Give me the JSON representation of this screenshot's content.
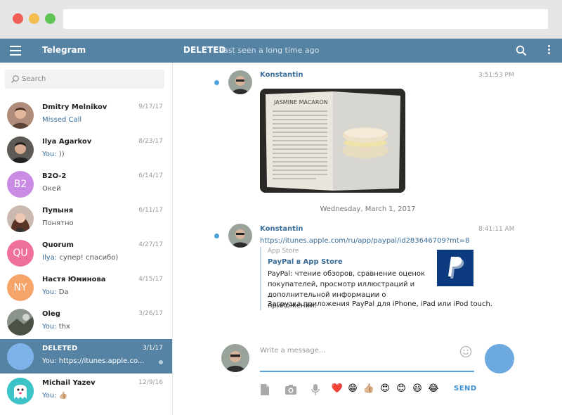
{
  "app": {
    "title": "Telegram"
  },
  "header": {
    "peer_name": "DELETED",
    "peer_status": "last seen a long time ago"
  },
  "search": {
    "placeholder": "Search",
    "value": ""
  },
  "dialogs": [
    {
      "name": "Dmitry Melnikov",
      "date": "9/17/17",
      "sender": "",
      "text": "Missed Call",
      "avatar_initials": "",
      "avatar_color": "#8a6b5b"
    },
    {
      "name": "Ilya Agarkov",
      "date": "8/23/17",
      "sender": "You:",
      "text": " ))",
      "avatar_initials": "",
      "avatar_color": "#3e3a36"
    },
    {
      "name": "B2O-2",
      "date": "6/14/17",
      "sender": "",
      "text": "Окей",
      "avatar_initials": "B2",
      "avatar_color": "#c98be3"
    },
    {
      "name": "Пупыня",
      "date": "6/11/17",
      "sender": "",
      "text": "Понятно",
      "avatar_initials": "",
      "avatar_color": "#6d4a3a"
    },
    {
      "name": "Quorum",
      "date": "4/27/17",
      "sender": "Ilya:",
      "text": " супер! спасибо)",
      "avatar_initials": "QU",
      "avatar_color": "#ef6f9d"
    },
    {
      "name": "Настя Юминова",
      "date": "4/15/17",
      "sender": "You:",
      "text": " Da",
      "avatar_initials": "NY",
      "avatar_color": "#f6a46a"
    },
    {
      "name": "Oleg",
      "date": "3/26/17",
      "sender": "You:",
      "text": " thx",
      "avatar_initials": "",
      "avatar_color": "#6f7a6c"
    },
    {
      "name": "DELETED",
      "date": "3/1/17",
      "sender": "",
      "text": "You: https://itunes.apple.co...",
      "avatar_initials": "",
      "avatar_color": "#7db3e8"
    },
    {
      "name": "Michail Yazev",
      "date": "12/9/16",
      "sender": "You:",
      "text": " 👍🏼",
      "avatar_initials": "",
      "avatar_color": "#3cc3c8"
    }
  ],
  "messages": [
    {
      "author": "Konstantin",
      "time": "3:51:53 PM",
      "type": "photo"
    },
    {
      "author": "Konstantin",
      "time": "8:41:11 AM",
      "type": "link",
      "link": "https://itunes.apple.com/ru/app/paypal/id283646709?mt=8",
      "webpage": {
        "site": "App Store",
        "title": "PayPal в App Store",
        "description": "PayPal: чтение обзоров, сравнение оценок покупателей, просмотр иллюстраций и дополнительной информации о приложении.",
        "description2": "Загрузка приложения PayPal для iPhone, iPad или iPod touch."
      }
    }
  ],
  "date_separator": "Wednesday, March 1, 2017",
  "composer": {
    "placeholder": "Write a message...",
    "value": "",
    "send_label": "SEND",
    "emojis": [
      "❤️",
      "😁",
      "👍🏼",
      "😍",
      "😊",
      "😃",
      "😂"
    ]
  },
  "colors": {
    "header": "#5682a3",
    "accent": "#3a6d99",
    "send": "#6ca9de",
    "unread": "#4ea3dc"
  }
}
